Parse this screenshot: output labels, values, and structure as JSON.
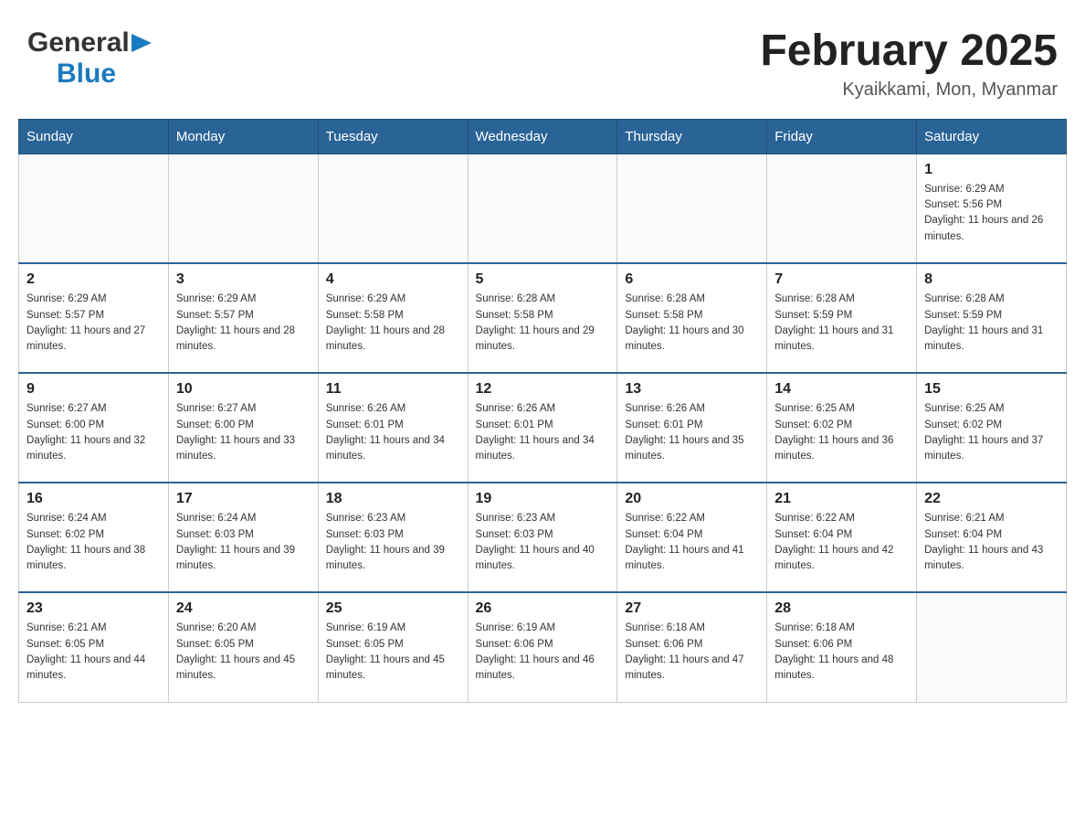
{
  "header": {
    "logo_general": "General",
    "logo_arrow": "▶",
    "logo_blue": "Blue",
    "title": "February 2025",
    "subtitle": "Kyaikkami, Mon, Myanmar"
  },
  "days_of_week": [
    "Sunday",
    "Monday",
    "Tuesday",
    "Wednesday",
    "Thursday",
    "Friday",
    "Saturday"
  ],
  "weeks": [
    {
      "cells": [
        {
          "day": "",
          "info": ""
        },
        {
          "day": "",
          "info": ""
        },
        {
          "day": "",
          "info": ""
        },
        {
          "day": "",
          "info": ""
        },
        {
          "day": "",
          "info": ""
        },
        {
          "day": "",
          "info": ""
        },
        {
          "day": "1",
          "info": "Sunrise: 6:29 AM\nSunset: 5:56 PM\nDaylight: 11 hours and 26 minutes."
        }
      ]
    },
    {
      "cells": [
        {
          "day": "2",
          "info": "Sunrise: 6:29 AM\nSunset: 5:57 PM\nDaylight: 11 hours and 27 minutes."
        },
        {
          "day": "3",
          "info": "Sunrise: 6:29 AM\nSunset: 5:57 PM\nDaylight: 11 hours and 28 minutes."
        },
        {
          "day": "4",
          "info": "Sunrise: 6:29 AM\nSunset: 5:58 PM\nDaylight: 11 hours and 28 minutes."
        },
        {
          "day": "5",
          "info": "Sunrise: 6:28 AM\nSunset: 5:58 PM\nDaylight: 11 hours and 29 minutes."
        },
        {
          "day": "6",
          "info": "Sunrise: 6:28 AM\nSunset: 5:58 PM\nDaylight: 11 hours and 30 minutes."
        },
        {
          "day": "7",
          "info": "Sunrise: 6:28 AM\nSunset: 5:59 PM\nDaylight: 11 hours and 31 minutes."
        },
        {
          "day": "8",
          "info": "Sunrise: 6:28 AM\nSunset: 5:59 PM\nDaylight: 11 hours and 31 minutes."
        }
      ]
    },
    {
      "cells": [
        {
          "day": "9",
          "info": "Sunrise: 6:27 AM\nSunset: 6:00 PM\nDaylight: 11 hours and 32 minutes."
        },
        {
          "day": "10",
          "info": "Sunrise: 6:27 AM\nSunset: 6:00 PM\nDaylight: 11 hours and 33 minutes."
        },
        {
          "day": "11",
          "info": "Sunrise: 6:26 AM\nSunset: 6:01 PM\nDaylight: 11 hours and 34 minutes."
        },
        {
          "day": "12",
          "info": "Sunrise: 6:26 AM\nSunset: 6:01 PM\nDaylight: 11 hours and 34 minutes."
        },
        {
          "day": "13",
          "info": "Sunrise: 6:26 AM\nSunset: 6:01 PM\nDaylight: 11 hours and 35 minutes."
        },
        {
          "day": "14",
          "info": "Sunrise: 6:25 AM\nSunset: 6:02 PM\nDaylight: 11 hours and 36 minutes."
        },
        {
          "day": "15",
          "info": "Sunrise: 6:25 AM\nSunset: 6:02 PM\nDaylight: 11 hours and 37 minutes."
        }
      ]
    },
    {
      "cells": [
        {
          "day": "16",
          "info": "Sunrise: 6:24 AM\nSunset: 6:02 PM\nDaylight: 11 hours and 38 minutes."
        },
        {
          "day": "17",
          "info": "Sunrise: 6:24 AM\nSunset: 6:03 PM\nDaylight: 11 hours and 39 minutes."
        },
        {
          "day": "18",
          "info": "Sunrise: 6:23 AM\nSunset: 6:03 PM\nDaylight: 11 hours and 39 minutes."
        },
        {
          "day": "19",
          "info": "Sunrise: 6:23 AM\nSunset: 6:03 PM\nDaylight: 11 hours and 40 minutes."
        },
        {
          "day": "20",
          "info": "Sunrise: 6:22 AM\nSunset: 6:04 PM\nDaylight: 11 hours and 41 minutes."
        },
        {
          "day": "21",
          "info": "Sunrise: 6:22 AM\nSunset: 6:04 PM\nDaylight: 11 hours and 42 minutes."
        },
        {
          "day": "22",
          "info": "Sunrise: 6:21 AM\nSunset: 6:04 PM\nDaylight: 11 hours and 43 minutes."
        }
      ]
    },
    {
      "cells": [
        {
          "day": "23",
          "info": "Sunrise: 6:21 AM\nSunset: 6:05 PM\nDaylight: 11 hours and 44 minutes."
        },
        {
          "day": "24",
          "info": "Sunrise: 6:20 AM\nSunset: 6:05 PM\nDaylight: 11 hours and 45 minutes."
        },
        {
          "day": "25",
          "info": "Sunrise: 6:19 AM\nSunset: 6:05 PM\nDaylight: 11 hours and 45 minutes."
        },
        {
          "day": "26",
          "info": "Sunrise: 6:19 AM\nSunset: 6:06 PM\nDaylight: 11 hours and 46 minutes."
        },
        {
          "day": "27",
          "info": "Sunrise: 6:18 AM\nSunset: 6:06 PM\nDaylight: 11 hours and 47 minutes."
        },
        {
          "day": "28",
          "info": "Sunrise: 6:18 AM\nSunset: 6:06 PM\nDaylight: 11 hours and 48 minutes."
        },
        {
          "day": "",
          "info": ""
        }
      ]
    }
  ]
}
